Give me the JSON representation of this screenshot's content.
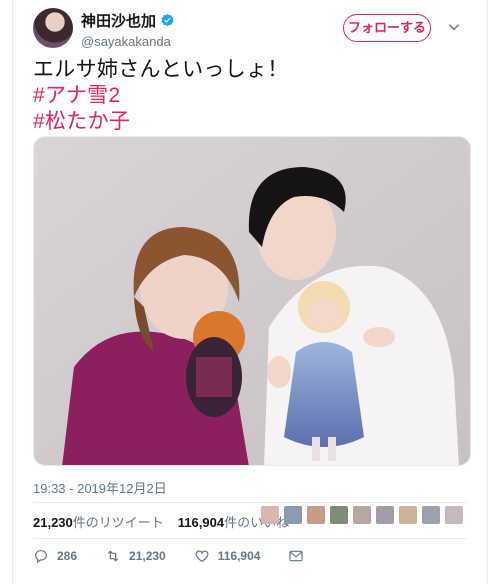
{
  "user": {
    "display_name": "神田沙也加",
    "handle": "@sayakakanda",
    "verified": true,
    "follow_label": "フォローする",
    "accent_color": "#e0245e"
  },
  "tweet": {
    "text_line": "エルサ姉さんといっしょ！",
    "hashtags": [
      "#アナ雪2",
      "#松たか子"
    ],
    "timestamp": "19:33 - 2019年12月2日"
  },
  "stats": {
    "retweets": "21,230",
    "retweets_label": "件のリツイート",
    "likes": "116,904",
    "likes_label": "件のいいね"
  },
  "actions": {
    "reply_count": "286",
    "retweet_count": "21,230",
    "like_count": "116,904"
  },
  "icons": {
    "verified": "verified-badge-icon",
    "chevron": "chevron-down-icon",
    "reply": "reply-icon",
    "retweet": "retweet-icon",
    "like": "heart-icon",
    "dm": "envelope-icon"
  }
}
